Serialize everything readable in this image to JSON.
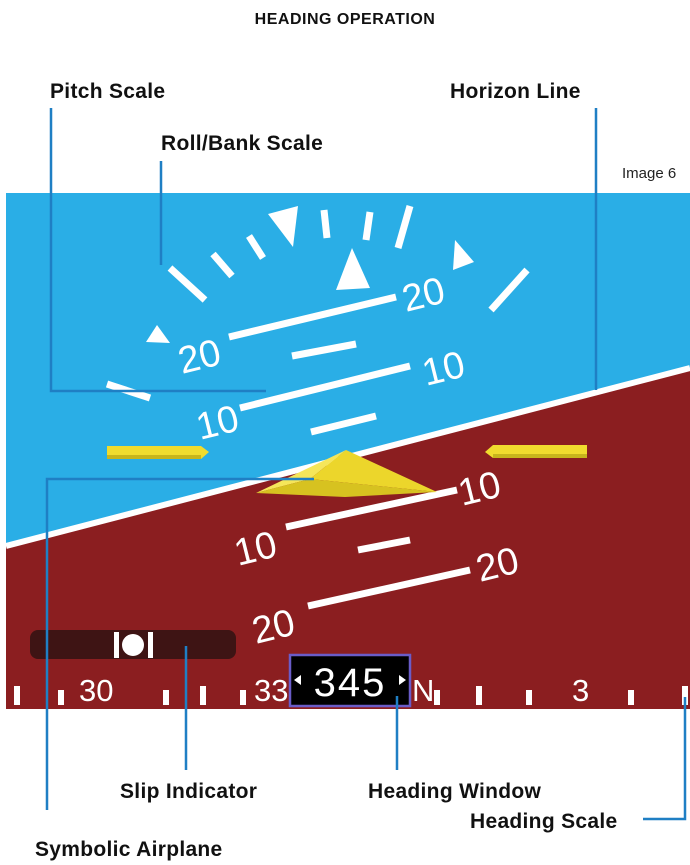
{
  "title": "HEADING OPERATION",
  "image_tag": "Image 6",
  "callouts": {
    "pitch_scale": "Pitch Scale",
    "horizon_line": "Horizon Line",
    "roll_bank_scale": "Roll/Bank Scale",
    "slip_indicator": "Slip Indicator",
    "heading_window": "Heading Window",
    "symbolic_airplane": "Symbolic Airplane",
    "heading_scale": "Heading Scale"
  },
  "pitch_labels": {
    "up_20_left": "20",
    "up_20_right": "20",
    "up_10_left": "10",
    "up_10_right": "10",
    "down_10_left": "10",
    "down_10_right": "10",
    "down_20_left": "20",
    "down_20_right": "20"
  },
  "heading": {
    "current": "345",
    "scale_labels": {
      "w30": "30",
      "w33": "33",
      "north": "N",
      "e3": "3"
    }
  },
  "colors": {
    "sky": "#2aaee6",
    "ground": "#8b1e20",
    "symbol_yellow": "#f0dc2e",
    "leader_blue": "#1f7fc4",
    "heading_window_border": "#6a5cc8"
  }
}
